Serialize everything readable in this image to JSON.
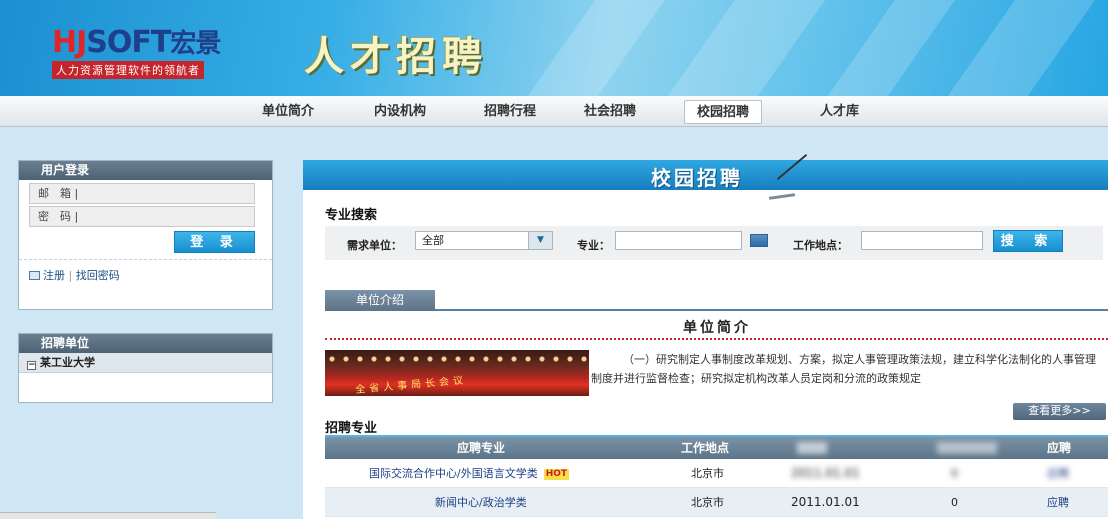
{
  "banner": {
    "logo_hj": "HJ",
    "logo_soft": "SOFT",
    "logo_cn": "宏景",
    "slogan": "人力资源管理软件的领航者",
    "title": "人才招聘"
  },
  "nav": {
    "items": [
      {
        "label": "单位简介"
      },
      {
        "label": "内设机构"
      },
      {
        "label": "招聘行程"
      },
      {
        "label": "社会招聘"
      },
      {
        "label": "校园招聘"
      },
      {
        "label": "人才库"
      }
    ],
    "active": "校园招聘"
  },
  "login": {
    "title": "用户登录",
    "email_label": "邮　箱 |",
    "password_label": "密　码 |",
    "submit": "登 录",
    "register": "注册",
    "forgot": "找回密码"
  },
  "units": {
    "title": "招聘单位",
    "items": [
      {
        "label": "某工业大学"
      }
    ]
  },
  "main": {
    "title": "校园招聘",
    "search": {
      "section_title": "专业搜索",
      "demand_label": "需求单位：",
      "demand_value": "全部",
      "major_label": "专业：",
      "location_label": "工作地点：",
      "button": "搜 索"
    },
    "tab_label": "单位介绍",
    "intro": {
      "title": "单位简介",
      "photo_caption": "全省人事局长会议",
      "text": "（一）研究制定人事制度改革规划、方案，拟定人事管理政策法规，建立科学化法制化的人事管理制度并进行监督检查；研究拟定机构改革人员定岗和分流的政策规定",
      "more": "查看更多>>"
    },
    "majors": {
      "section_title": "招聘专业",
      "headers": [
        "应聘专业",
        "工作地点",
        "",
        "",
        "应聘"
      ],
      "rows": [
        {
          "major": "国际交流合作中心/外国语言文学类",
          "hot": "HOT",
          "location": "北京市",
          "date": "2011.01.01",
          "count": "0",
          "apply": "应聘"
        },
        {
          "major": "新闻中心/政治学类",
          "hot": "",
          "location": "北京市",
          "date": "2011.01.01",
          "count": "0",
          "apply": "应聘"
        }
      ]
    }
  }
}
